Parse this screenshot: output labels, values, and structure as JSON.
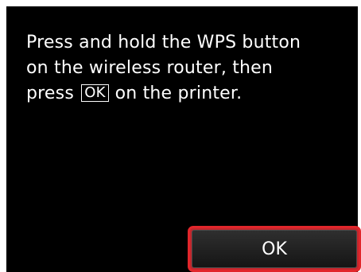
{
  "message": {
    "line1": "Press and hold the WPS button",
    "line2": "on the wireless router, then",
    "line3_before": "press",
    "line3_key": "OK",
    "line3_after": "on the printer."
  },
  "ok_button": {
    "label": "OK"
  },
  "colors": {
    "screen_background": "#000000",
    "text": "#ffffff",
    "button_highlight": "#e1262b"
  }
}
